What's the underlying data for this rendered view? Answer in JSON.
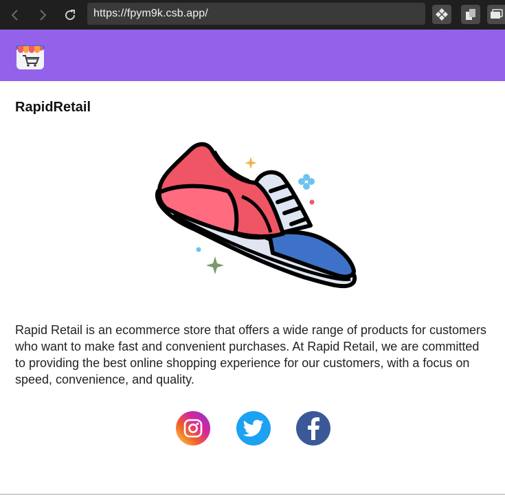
{
  "browser": {
    "url": "https://fpym9k.csb.app/",
    "back_icon": "chevron-left-icon",
    "forward_icon": "chevron-right-icon",
    "reload_icon": "reload-icon"
  },
  "header": {
    "background_color": "#9461eb",
    "logo_icon": "store-cart-icon"
  },
  "main": {
    "title": "RapidRetail",
    "hero_icon": "sneaker-illustration",
    "description": "Rapid Retail is an ecommerce store that offers a wide range of products for customers who want to make fast and convenient purchases. At Rapid Retail, we are committed to providing the best online shopping experience for our customers, with a focus on speed, convenience, and quality."
  },
  "social": [
    {
      "name": "instagram",
      "icon": "instagram-icon",
      "color": "#d6249f"
    },
    {
      "name": "twitter",
      "icon": "twitter-icon",
      "color": "#1da1f2"
    },
    {
      "name": "facebook",
      "icon": "facebook-icon",
      "color": "#3b5998"
    }
  ]
}
